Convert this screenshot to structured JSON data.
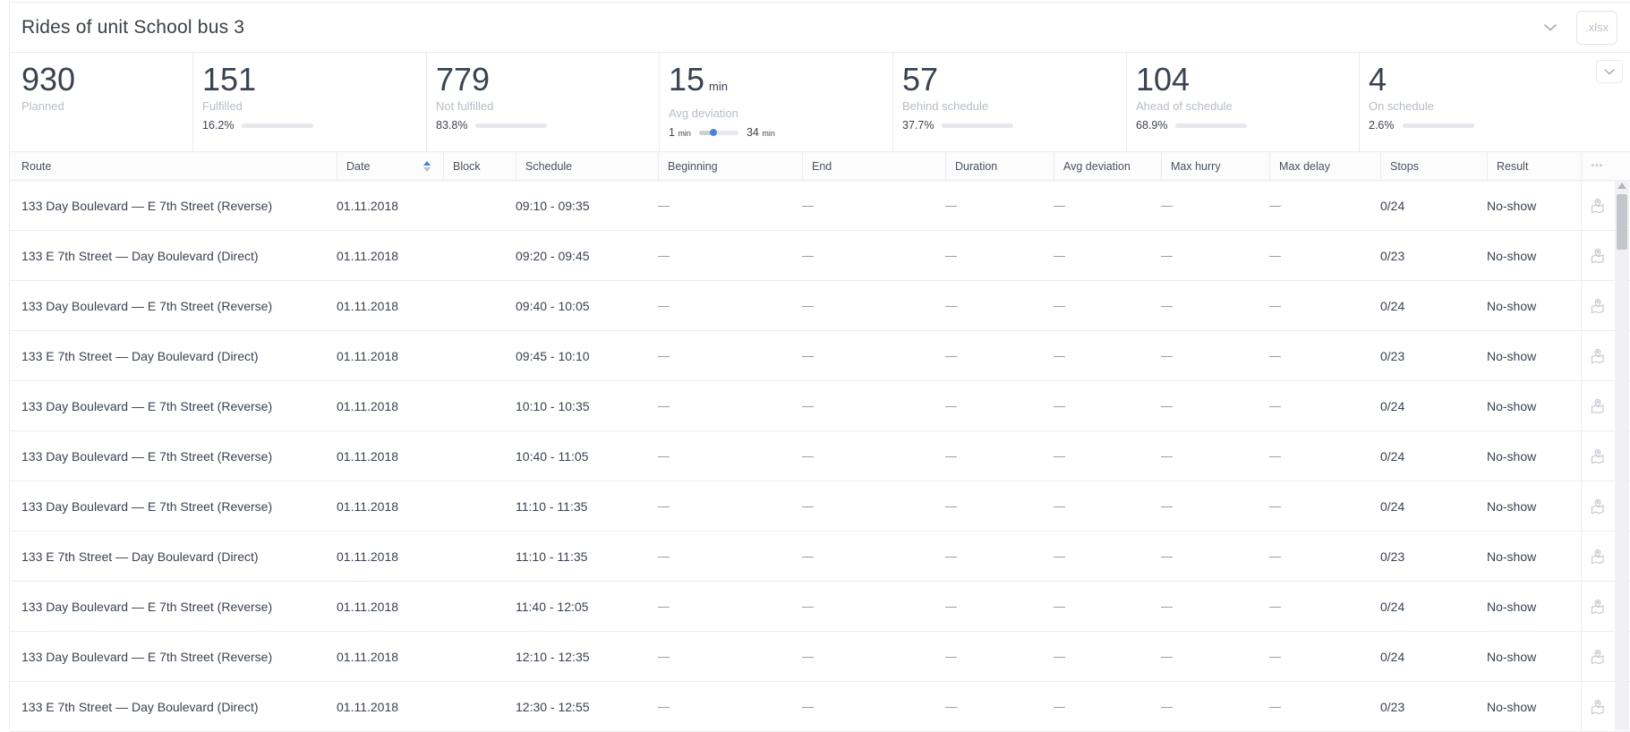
{
  "header": {
    "title": "Rides of unit School bus 3",
    "export_label": ".xlsx"
  },
  "icons": {
    "more": "•••"
  },
  "colors": {
    "green": "#3eb95f",
    "red": "#f2615e",
    "amber": "#fbb418",
    "blue": "#4a84d9"
  },
  "stats": [
    {
      "value": "930",
      "label": "Planned"
    },
    {
      "value": "151",
      "label": "Fulfilled",
      "percent": "16.2%",
      "bar_fill": 16.2,
      "bar_color": "#3eb95f"
    },
    {
      "value": "779",
      "label": "Not fulfilled",
      "percent": "83.8%",
      "bar_fill": 83.8,
      "bar_color": "#f2615e"
    },
    {
      "value": "15",
      "unit": "min",
      "label": "Avg deviation",
      "range": {
        "min_value": "1",
        "min_unit": "min",
        "max_value": "34",
        "max_unit": "min",
        "pos": 37
      }
    },
    {
      "value": "57",
      "label": "Behind schedule",
      "percent": "37.7%",
      "bar_fill": 37.7,
      "bar_color": "#f2615e"
    },
    {
      "value": "104",
      "label": "Ahead of schedule",
      "percent": "68.9%",
      "bar_fill": 68.9,
      "bar_color": "#fbb418"
    },
    {
      "value": "4",
      "label": "On schedule",
      "percent": "2.6%",
      "bar_fill": 2.6,
      "bar_color": "#3eb95f"
    }
  ],
  "table": {
    "columns": [
      "Route",
      "Date",
      "Block",
      "Schedule",
      "Beginning",
      "End",
      "Duration",
      "Avg deviation",
      "Max hurry",
      "Max delay",
      "Stops",
      "Result"
    ],
    "sorted_column": "Date",
    "sort_direction": "asc",
    "rows": [
      [
        "133 Day Boulevard — E 7th Street (Reverse)",
        "01.11.2018",
        "",
        "09:10 - 09:35",
        "—",
        "—",
        "—",
        "—",
        "—",
        "—",
        "0/24",
        "No-show"
      ],
      [
        "133 E 7th Street — Day Boulevard (Direct)",
        "01.11.2018",
        "",
        "09:20 - 09:45",
        "—",
        "—",
        "—",
        "—",
        "—",
        "—",
        "0/23",
        "No-show"
      ],
      [
        "133 Day Boulevard — E 7th Street (Reverse)",
        "01.11.2018",
        "",
        "09:40 - 10:05",
        "—",
        "—",
        "—",
        "—",
        "—",
        "—",
        "0/24",
        "No-show"
      ],
      [
        "133 E 7th Street — Day Boulevard (Direct)",
        "01.11.2018",
        "",
        "09:45 - 10:10",
        "—",
        "—",
        "—",
        "—",
        "—",
        "—",
        "0/23",
        "No-show"
      ],
      [
        "133 Day Boulevard — E 7th Street (Reverse)",
        "01.11.2018",
        "",
        "10:10 - 10:35",
        "—",
        "—",
        "—",
        "—",
        "—",
        "—",
        "0/24",
        "No-show"
      ],
      [
        "133 Day Boulevard — E 7th Street (Reverse)",
        "01.11.2018",
        "",
        "10:40 - 11:05",
        "—",
        "—",
        "—",
        "—",
        "—",
        "—",
        "0/24",
        "No-show"
      ],
      [
        "133 Day Boulevard — E 7th Street (Reverse)",
        "01.11.2018",
        "",
        "11:10 - 11:35",
        "—",
        "—",
        "—",
        "—",
        "—",
        "—",
        "0/24",
        "No-show"
      ],
      [
        "133 E 7th Street — Day Boulevard (Direct)",
        "01.11.2018",
        "",
        "11:10 - 11:35",
        "—",
        "—",
        "—",
        "—",
        "—",
        "—",
        "0/23",
        "No-show"
      ],
      [
        "133 Day Boulevard — E 7th Street (Reverse)",
        "01.11.2018",
        "",
        "11:40 - 12:05",
        "—",
        "—",
        "—",
        "—",
        "—",
        "—",
        "0/24",
        "No-show"
      ],
      [
        "133 Day Boulevard — E 7th Street (Reverse)",
        "01.11.2018",
        "",
        "12:10 - 12:35",
        "—",
        "—",
        "—",
        "—",
        "—",
        "—",
        "0/24",
        "No-show"
      ],
      [
        "133 E 7th Street — Day Boulevard (Direct)",
        "01.11.2018",
        "",
        "12:30 - 12:55",
        "—",
        "—",
        "—",
        "—",
        "—",
        "—",
        "0/23",
        "No-show"
      ]
    ]
  }
}
